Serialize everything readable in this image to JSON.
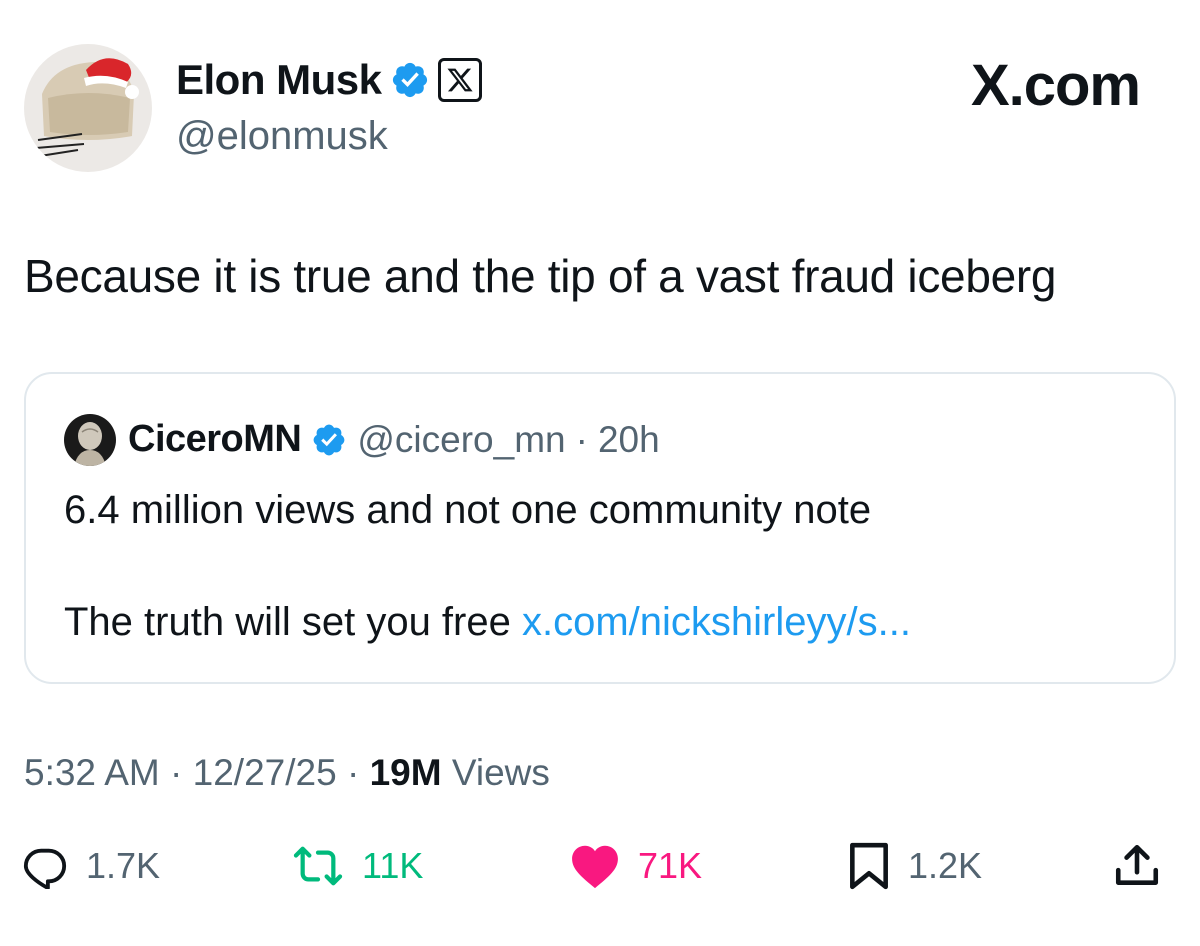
{
  "author": {
    "name": "Elon Musk",
    "handle": "@elonmusk",
    "verified": true,
    "affiliate_badge": "x-logo-icon"
  },
  "brand": "X.com",
  "tweet": {
    "text": "Because it is true and the tip of a vast fraud iceberg"
  },
  "quote": {
    "name": "CiceroMN",
    "handle": "@cicero_mn",
    "separator": "·",
    "time": "20h",
    "line1": "6.4 million views and not one community note",
    "line2_text": "The truth will set you free ",
    "line2_link": "x.com/nickshirleyy/s..."
  },
  "meta": {
    "time": "5:32 AM",
    "sep1": " · ",
    "date": "12/27/25",
    "sep2": " · ",
    "views_count": "19M",
    "views_label": " Views"
  },
  "actions": {
    "replies": "1.7K",
    "reposts": "11K",
    "likes": "71K",
    "bookmarks": "1.2K"
  },
  "colors": {
    "verified": "#1d9bf0",
    "link": "#1d9bf0",
    "repost": "#00ba7c",
    "like": "#f91880",
    "muted": "#536471",
    "text": "#0f1419"
  }
}
